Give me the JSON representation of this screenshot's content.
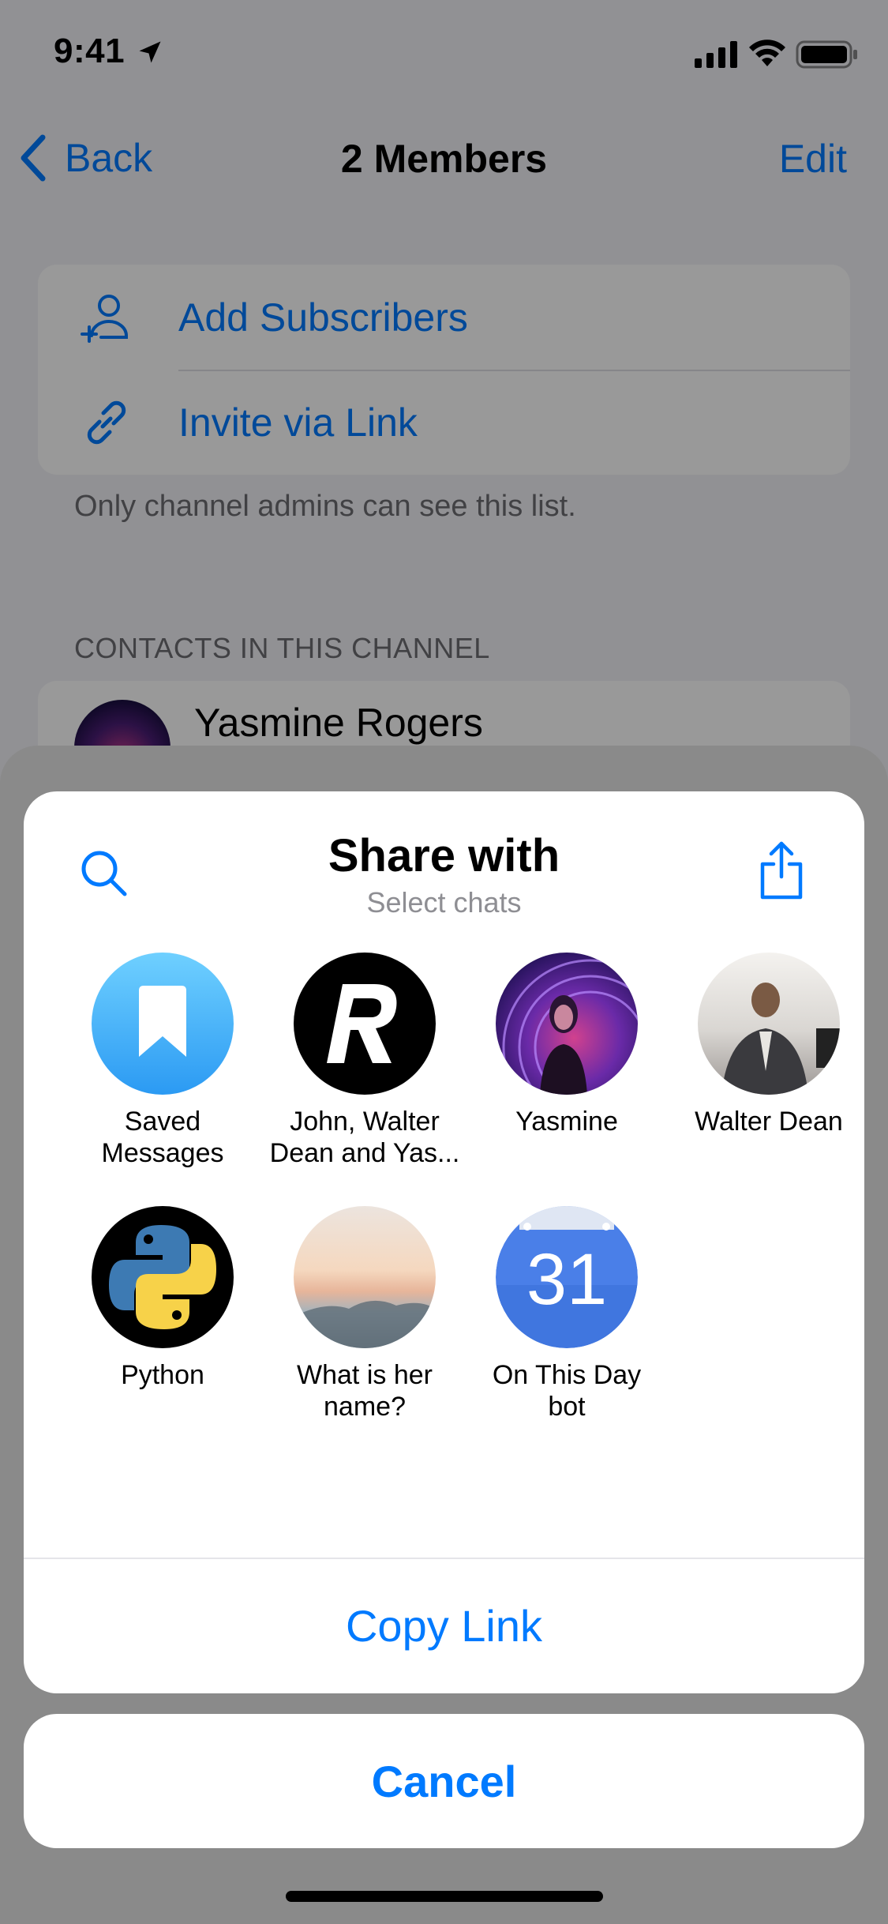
{
  "status_bar": {
    "time": "9:41"
  },
  "nav": {
    "back_label": "Back",
    "title": "2 Members",
    "edit_label": "Edit"
  },
  "actions": [
    {
      "label": "Add Subscribers",
      "icon": "add-person-icon"
    },
    {
      "label": "Invite via Link",
      "icon": "link-icon"
    }
  ],
  "footnote": "Only channel admins can see this list.",
  "section_header": "CONTACTS IN THIS CHANNEL",
  "contacts": [
    {
      "name": "Yasmine Rogers"
    }
  ],
  "share": {
    "title": "Share with",
    "subtitle": "Select chats",
    "chats": [
      {
        "name": "Saved\nMessages",
        "avatar": "saved-messages"
      },
      {
        "name": "John, Walter\nDean and Yas...",
        "avatar": "letter-r"
      },
      {
        "name": "Yasmine",
        "avatar": "photo"
      },
      {
        "name": "Walter Dean",
        "avatar": "photo"
      },
      {
        "name": "Python",
        "avatar": "python-logo"
      },
      {
        "name": "What is her\nname?",
        "avatar": "photo"
      },
      {
        "name": "On This Day\nbot",
        "avatar": "calendar-31"
      }
    ],
    "copy_link_label": "Copy Link",
    "cancel_label": "Cancel"
  },
  "colors": {
    "accent": "#007aff",
    "overlay": "#00000066"
  }
}
